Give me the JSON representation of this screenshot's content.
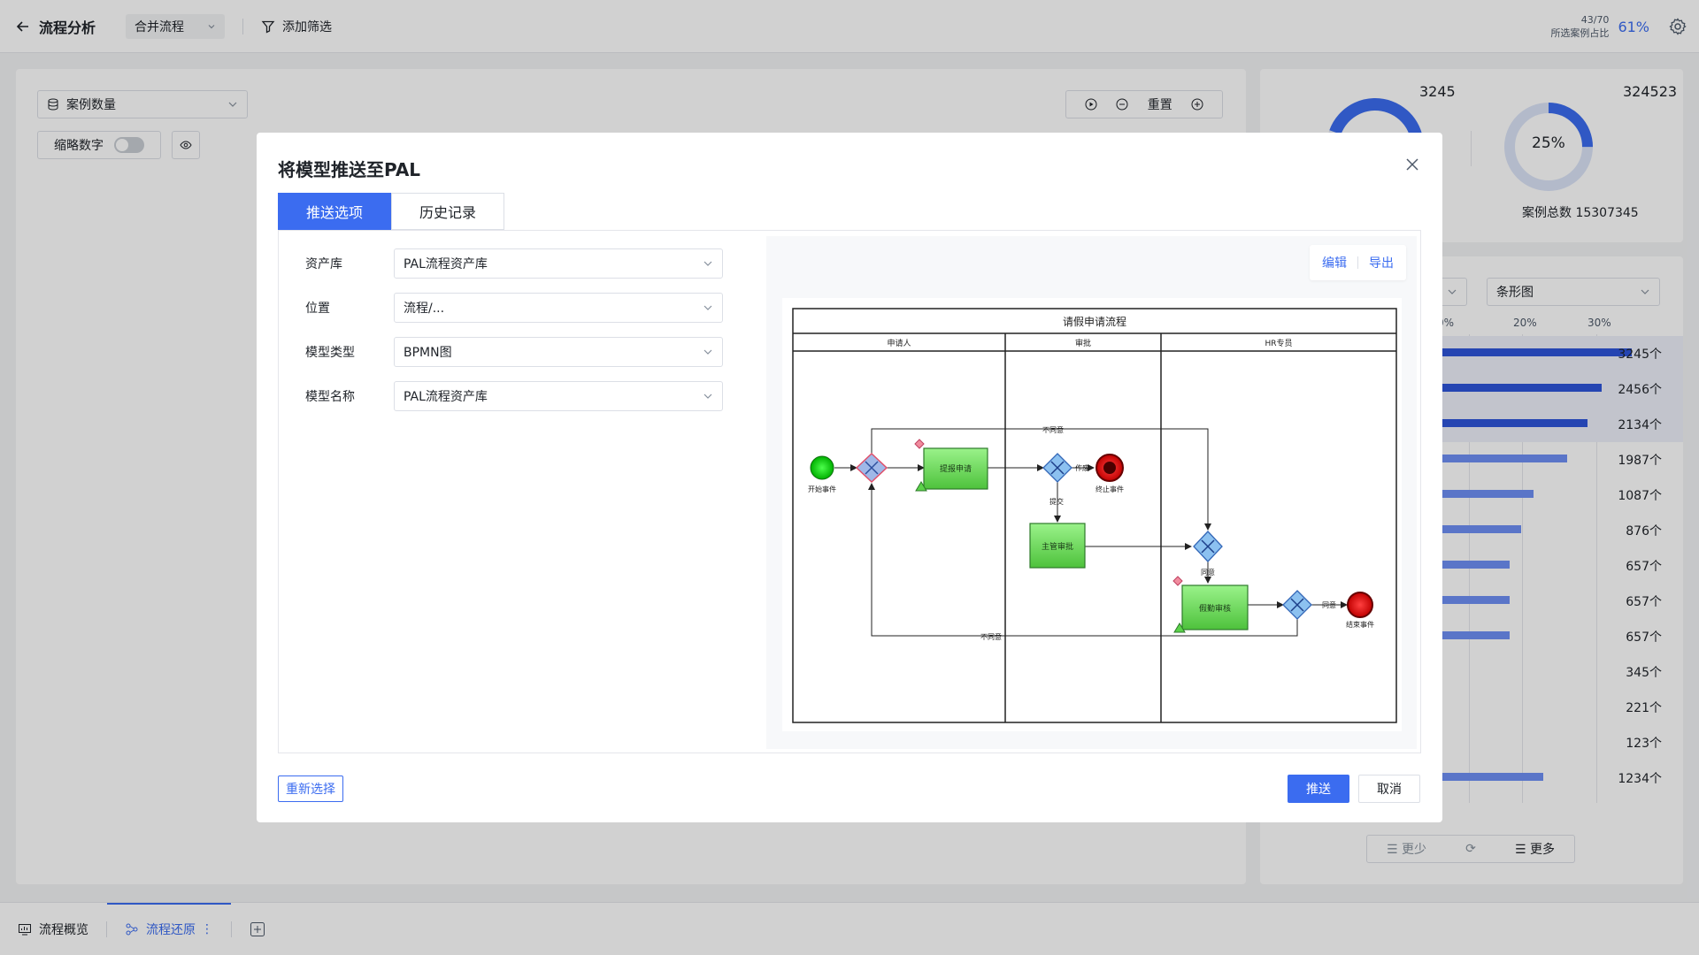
{
  "topbar": {
    "title": "流程分析",
    "merge_select": "合并流程",
    "filter_label": "添加筛选",
    "ratio_count": "43/70",
    "ratio_label": "所选案例占比",
    "ratio_pct": "61%"
  },
  "left": {
    "metric_select": "案例数量",
    "thumb_label": "缩略数字",
    "zoom_reset": "重置"
  },
  "right_top": {
    "donut1_value": "3245",
    "donut2_value": "324523",
    "donut2_pct": "25%",
    "donut2_fraction": 0.25,
    "total_label": "案例总数",
    "total_value": "15307345",
    "accent": "#3b6cf0"
  },
  "right_bottom": {
    "chart_select": "条形图",
    "ticks": [
      "0%",
      "20%",
      "30%"
    ],
    "bars": [
      {
        "value": "3245个",
        "fraction": 0.95
      },
      {
        "value": "2456个",
        "fraction": 0.8
      },
      {
        "value": "2134个",
        "fraction": 0.73
      },
      {
        "value": "1987个",
        "fraction": 0.63
      },
      {
        "value": "1087个",
        "fraction": 0.46
      },
      {
        "value": "876个",
        "fraction": 0.4
      },
      {
        "value": "657个",
        "fraction": 0.34
      },
      {
        "value": "657个",
        "fraction": 0.34
      },
      {
        "value": "657个",
        "fraction": 0.34
      },
      {
        "value": "345个",
        "fraction": 0.0
      },
      {
        "value": "221个",
        "fraction": 0.0
      },
      {
        "value": "123个",
        "fraction": 0.0
      },
      {
        "value": "1234个",
        "fraction": 0.51
      }
    ],
    "less_label": "更少",
    "more_label": "更多"
  },
  "bottom_tabs": {
    "overview": "流程概览",
    "restore": "流程还原"
  },
  "modal": {
    "title": "将模型推送至PAL",
    "tabs": [
      "推送选项",
      "历史记录"
    ],
    "form": [
      {
        "label": "资产库",
        "value": "PAL流程资产库"
      },
      {
        "label": "位置",
        "value": "流程/..."
      },
      {
        "label": "模型类型",
        "value": "BPMN图"
      },
      {
        "label": "模型名称",
        "value": "PAL流程资产库"
      }
    ],
    "edit_label": "编辑",
    "export_label": "导出",
    "reselect_label": "重新选择",
    "push_label": "推送",
    "cancel_label": "取消"
  },
  "diagram": {
    "title": "请假申请流程",
    "lanes": [
      "申请人",
      "审批",
      "HR专员"
    ],
    "start_event": "开始事件",
    "apply_task": "提报申请",
    "void_label": "作废",
    "end_stop": "终止事件",
    "submit_label": "提交",
    "manager_task": "主管审批",
    "agree_label": "同意",
    "hr_task": "假勤审核",
    "agree2_label": "同意",
    "end_event": "结束事件",
    "disagree_top": "不同意",
    "disagree_bottom": "不同意"
  }
}
